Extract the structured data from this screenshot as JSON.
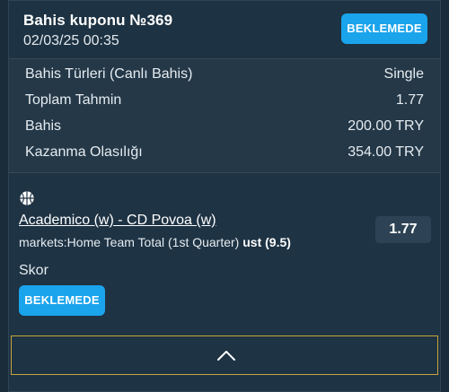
{
  "coupon": {
    "title": "Bahis kuponu №369",
    "datetime": "02/03/25 00:35",
    "status": "BEKLEMEDE"
  },
  "summary": [
    {
      "label": "Bahis Türleri (Canlı Bahis)",
      "value": "Single"
    },
    {
      "label": "Toplam Tahmin",
      "value": "1.77"
    },
    {
      "label": "Bahis",
      "value": "200.00 TRY"
    },
    {
      "label": "Kazanma Olasılığı",
      "value": "354.00 TRY"
    }
  ],
  "selection": {
    "sport_icon": "basketball-icon",
    "match": "Academico (w) - CD Povoa (w)",
    "market_prefix": "markets:Home Team Total (1st Quarter) ",
    "market_pick": "ust (9.5)",
    "odds": "1.77",
    "score_label": "Skor",
    "status": "BEKLEMEDE"
  },
  "footer": {
    "expand_icon": "chevron-up-icon"
  },
  "colors": {
    "accent": "#1aa4ec",
    "background": "#1a2b3a",
    "card": "#1e3344",
    "expand_border": "#c9a43a"
  }
}
